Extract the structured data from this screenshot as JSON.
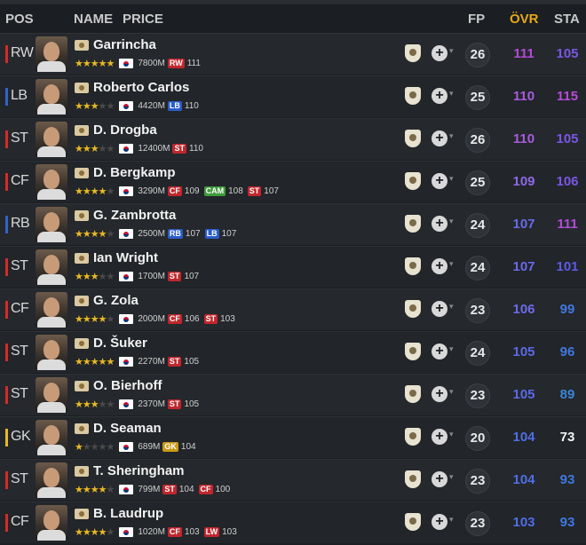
{
  "header": {
    "pos": "POS",
    "name": "NAME",
    "price": "PRICE",
    "fp": "FP",
    "ovr": "ÖVR",
    "sta": "STA"
  },
  "colors": {
    "ovr_header": "#e6a817",
    "pos_bar_forward": "#d12c2c",
    "pos_bar_defender": "#2f64c8",
    "pos_bar_gk": "#e8b923"
  },
  "players": [
    {
      "pos": "RW",
      "bar": "#d12c2c",
      "name": "Garrincha",
      "stars": 5,
      "price": "7800M",
      "chips": [
        {
          "pos": "RW",
          "val": "111",
          "color": "#c0262d"
        }
      ],
      "fp": "26",
      "ovr": "111",
      "ovr_color": "#b44cd8",
      "sta": "105",
      "sta_color": "#7a57e6"
    },
    {
      "pos": "LB",
      "bar": "#2f64c8",
      "name": "Roberto Carlos",
      "stars": 3,
      "price": "4420M",
      "chips": [
        {
          "pos": "LB",
          "val": "110",
          "color": "#2a5cc8"
        }
      ],
      "fp": "25",
      "ovr": "110",
      "ovr_color": "#a95be0",
      "sta": "115",
      "sta_color": "#b44cd8"
    },
    {
      "pos": "ST",
      "bar": "#d12c2c",
      "name": "D. Drogba",
      "stars": 3,
      "price": "12400M",
      "chips": [
        {
          "pos": "ST",
          "val": "110",
          "color": "#c0262d"
        }
      ],
      "fp": "26",
      "ovr": "110",
      "ovr_color": "#a95be0",
      "sta": "105",
      "sta_color": "#7a57e6"
    },
    {
      "pos": "CF",
      "bar": "#d12c2c",
      "name": "D. Bergkamp",
      "stars": 4,
      "price": "3290M",
      "chips": [
        {
          "pos": "CF",
          "val": "109",
          "color": "#c0262d"
        },
        {
          "pos": "CAM",
          "val": "108",
          "color": "#3f9a3a"
        },
        {
          "pos": "ST",
          "val": "107",
          "color": "#c0262d"
        }
      ],
      "fp": "25",
      "ovr": "109",
      "ovr_color": "#8e6ae6",
      "sta": "106",
      "sta_color": "#7a57e6"
    },
    {
      "pos": "RB",
      "bar": "#2f64c8",
      "name": "G. Zambrotta",
      "stars": 4,
      "price": "2500M",
      "chips": [
        {
          "pos": "RB",
          "val": "107",
          "color": "#2a5cc8"
        },
        {
          "pos": "LB",
          "val": "107",
          "color": "#2a5cc8"
        }
      ],
      "fp": "24",
      "ovr": "107",
      "ovr_color": "#6a6ae8",
      "sta": "111",
      "sta_color": "#b44cd8"
    },
    {
      "pos": "ST",
      "bar": "#d12c2c",
      "name": "Ian Wright",
      "stars": 3,
      "price": "1700M",
      "chips": [
        {
          "pos": "ST",
          "val": "107",
          "color": "#c0262d"
        }
      ],
      "fp": "24",
      "ovr": "107",
      "ovr_color": "#6a6ae8",
      "sta": "101",
      "sta_color": "#5b5be6"
    },
    {
      "pos": "CF",
      "bar": "#d12c2c",
      "name": "G. Zola",
      "stars": 4,
      "price": "2000M",
      "chips": [
        {
          "pos": "CF",
          "val": "106",
          "color": "#c0262d"
        },
        {
          "pos": "ST",
          "val": "103",
          "color": "#c0262d"
        }
      ],
      "fp": "23",
      "ovr": "106",
      "ovr_color": "#6a6ae8",
      "sta": "99",
      "sta_color": "#3f78e0"
    },
    {
      "pos": "ST",
      "bar": "#d12c2c",
      "name": "D. Šuker",
      "stars": 5,
      "price": "2270M",
      "chips": [
        {
          "pos": "ST",
          "val": "105",
          "color": "#c0262d"
        }
      ],
      "fp": "24",
      "ovr": "105",
      "ovr_color": "#5b6ae6",
      "sta": "96",
      "sta_color": "#3f78e0"
    },
    {
      "pos": "ST",
      "bar": "#d12c2c",
      "name": "O. Bierhoff",
      "stars": 3,
      "price": "2370M",
      "chips": [
        {
          "pos": "ST",
          "val": "105",
          "color": "#c0262d"
        }
      ],
      "fp": "23",
      "ovr": "105",
      "ovr_color": "#5b6ae6",
      "sta": "89",
      "sta_color": "#3a86d8"
    },
    {
      "pos": "GK",
      "bar": "#e8b923",
      "name": "D. Seaman",
      "stars": 1,
      "price": "689M",
      "chips": [
        {
          "pos": "GK",
          "val": "104",
          "color": "#c99a16"
        }
      ],
      "fp": "20",
      "ovr": "104",
      "ovr_color": "#4f6ee6",
      "sta": "73",
      "sta_color": "#f2f2f2"
    },
    {
      "pos": "ST",
      "bar": "#d12c2c",
      "name": "T. Sheringham",
      "stars": 4,
      "price": "799M",
      "chips": [
        {
          "pos": "ST",
          "val": "104",
          "color": "#c0262d"
        },
        {
          "pos": "CF",
          "val": "100",
          "color": "#c0262d"
        }
      ],
      "fp": "23",
      "ovr": "104",
      "ovr_color": "#4f6ee6",
      "sta": "93",
      "sta_color": "#3f78e0"
    },
    {
      "pos": "CF",
      "bar": "#d12c2c",
      "name": "B. Laudrup",
      "stars": 4,
      "price": "1020M",
      "chips": [
        {
          "pos": "CF",
          "val": "103",
          "color": "#c0262d"
        },
        {
          "pos": "LW",
          "val": "103",
          "color": "#c0262d"
        }
      ],
      "fp": "23",
      "ovr": "103",
      "ovr_color": "#4f6ee6",
      "sta": "93",
      "sta_color": "#3f78e0"
    }
  ]
}
